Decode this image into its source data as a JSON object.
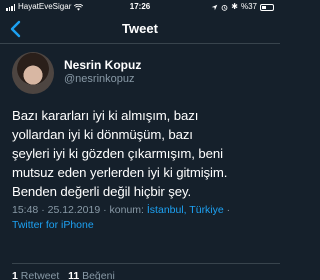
{
  "status_bar": {
    "carrier": "HayatEveSigar",
    "time": "17:26",
    "battery_percent": "%37"
  },
  "nav": {
    "title": "Tweet"
  },
  "author": {
    "display_name": "Nesrin Kopuz",
    "handle": "@nesrinkopuz"
  },
  "tweet": {
    "lines": [
      "Bazı kararları iyi ki almışım, bazı",
      "yollardan  iyi ki dönmüşüm, bazı",
      "şeyleri iyi ki gözden çıkarmışım, beni",
      "mutsuz eden yerlerden iyi ki gitmişim.",
      "Benden değerli değil hiçbir şey."
    ]
  },
  "meta": {
    "time": "15:48",
    "date": "25.12.2019",
    "location_label": "konum:",
    "location": "İstanbul, Türkiye",
    "client": "Twitter for iPhone"
  },
  "stats": {
    "retweets_count": "1",
    "retweets_label": "Retweet",
    "likes_count": "11",
    "likes_label": "Beğeni"
  },
  "colors": {
    "background": "#15202b",
    "link": "#1da1f2",
    "secondary_text": "#8899a6",
    "divider": "#38444d"
  }
}
